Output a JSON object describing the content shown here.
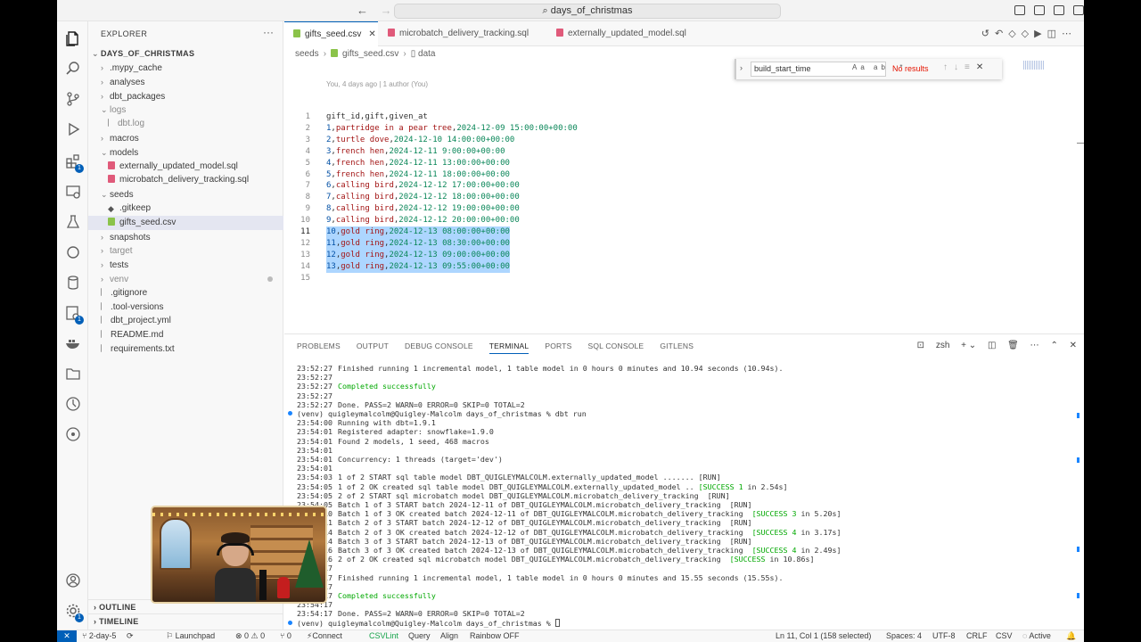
{
  "titlebar": {
    "back": "←",
    "forward": "→",
    "search_icon": "⌕",
    "command_center": "days_of_christmas"
  },
  "sidebar": {
    "header": "EXPLORER",
    "more": "···",
    "root": "DAYS_OF_CHRISTMAS",
    "items": [
      {
        "label": ".mypy_cache",
        "type": "folder",
        "open": false,
        "depth": 1
      },
      {
        "label": "analyses",
        "type": "folder",
        "open": false,
        "depth": 1
      },
      {
        "label": "dbt_packages",
        "type": "folder",
        "open": false,
        "depth": 1
      },
      {
        "label": "logs",
        "type": "folder",
        "open": true,
        "depth": 1,
        "dim": true
      },
      {
        "label": "dbt.log",
        "type": "file",
        "icon": "txt",
        "depth": 2,
        "dim": true
      },
      {
        "label": "macros",
        "type": "folder",
        "open": false,
        "depth": 1
      },
      {
        "label": "models",
        "type": "folder",
        "open": true,
        "depth": 1
      },
      {
        "label": "externally_updated_model.sql",
        "type": "file",
        "icon": "sql",
        "depth": 2
      },
      {
        "label": "microbatch_delivery_tracking.sql",
        "type": "file",
        "icon": "sql",
        "depth": 2
      },
      {
        "label": "seeds",
        "type": "folder",
        "open": true,
        "depth": 1
      },
      {
        "label": ".gitkeep",
        "type": "file",
        "icon": "git",
        "depth": 2
      },
      {
        "label": "gifts_seed.csv",
        "type": "file",
        "icon": "csv",
        "depth": 2,
        "selected": true
      },
      {
        "label": "snapshots",
        "type": "folder",
        "open": false,
        "depth": 1
      },
      {
        "label": "target",
        "type": "folder",
        "open": false,
        "depth": 1,
        "dim": true
      },
      {
        "label": "tests",
        "type": "folder",
        "open": false,
        "depth": 1
      },
      {
        "label": "venv",
        "type": "folder",
        "open": false,
        "depth": 1,
        "dim": true
      },
      {
        "label": ".gitignore",
        "type": "file",
        "icon": "txt",
        "depth": 1
      },
      {
        "label": ".tool-versions",
        "type": "file",
        "icon": "txt",
        "depth": 1
      },
      {
        "label": "dbt_project.yml",
        "type": "file",
        "icon": "txt",
        "depth": 1
      },
      {
        "label": "README.md",
        "type": "file",
        "icon": "txt",
        "depth": 1
      },
      {
        "label": "requirements.txt",
        "type": "file",
        "icon": "txt",
        "depth": 1
      }
    ],
    "outline": "OUTLINE",
    "timeline": "TIMELINE"
  },
  "editor": {
    "tabs": [
      {
        "label": "gifts_seed.csv",
        "icon": "csv",
        "active": true
      },
      {
        "label": "microbatch_delivery_tracking.sql",
        "icon": "sql",
        "active": false
      },
      {
        "label": "externally_updated_model.sql",
        "icon": "sql",
        "active": false
      }
    ],
    "close": "✕",
    "breadcrumb": [
      "seeds",
      "gifts_seed.csv",
      "data"
    ],
    "blame": "You, 4 days ago | 1 author (You)",
    "lines": [
      "gift_id,gift,given_at",
      "1,partridge in a pear tree,2024-12-09 15:00:00+00:00",
      "2,turtle dove,2024-12-10 14:00:00+00:00",
      "3,french hen,2024-12-11 9:00:00+00:00",
      "4,french hen,2024-12-11 13:00:00+00:00",
      "5,french hen,2024-12-11 18:00:00+00:00",
      "6,calling bird,2024-12-12 17:00:00+00:00",
      "7,calling bird,2024-12-12 18:00:00+00:00",
      "8,calling bird,2024-12-12 19:00:00+00:00",
      "9,calling bird,2024-12-12 20:00:00+00:00",
      "10,gold ring,2024-12-13 08:00:00+00:00",
      "11,gold ring,2024-12-13 08:30:00+00:00",
      "12,gold ring,2024-12-13 09:00:00+00:00",
      "13,gold ring,2024-12-13 09:55:00+00:00",
      ""
    ],
    "selected_lines": [
      11,
      12,
      13,
      14
    ],
    "current_line": 11
  },
  "find": {
    "query": "build_start_time",
    "options": "Aa ab .*",
    "result": "No results"
  },
  "panel": {
    "tabs": [
      "PROBLEMS",
      "OUTPUT",
      "DEBUG CONSOLE",
      "TERMINAL",
      "PORTS",
      "SQL CONSOLE",
      "GITLENS"
    ],
    "active_tab": "TERMINAL",
    "shell": "zsh",
    "terminal": [
      {
        "ts": "23:52:27",
        "text": "Finished running 1 incremental model, 1 table model in 0 hours 0 minutes and 10.94 seconds (10.94s)."
      },
      {
        "ts": "23:52:27",
        "text": ""
      },
      {
        "ts": "23:52:27",
        "text": "Completed successfully",
        "green": true
      },
      {
        "ts": "23:52:27",
        "text": ""
      },
      {
        "ts": "23:52:27",
        "text": "Done. PASS=2 WARN=0 ERROR=0 SKIP=0 TOTAL=2"
      },
      {
        "ts": "",
        "text": "(venv) quigleymalcolm@Quigley-Malcolm days_of_christmas % dbt run",
        "prompt": true
      },
      {
        "ts": "23:54:00",
        "text": "Running with dbt=1.9.1"
      },
      {
        "ts": "23:54:01",
        "text": "Registered adapter: snowflake=1.9.0"
      },
      {
        "ts": "23:54:01",
        "text": "Found 2 models, 1 seed, 468 macros"
      },
      {
        "ts": "23:54:01",
        "text": ""
      },
      {
        "ts": "23:54:01",
        "text": "Concurrency: 1 threads (target='dev')"
      },
      {
        "ts": "23:54:01",
        "text": ""
      },
      {
        "ts": "23:54:03",
        "text": "1 of 2 START sql table model DBT_QUIGLEYMALCOLM.externally_updated_model ....... [RUN]"
      },
      {
        "ts": "23:54:05",
        "text": "1 of 2 OK created sql table model DBT_QUIGLEYMALCOLM.externally_updated_model .. ",
        "green_tail": "[SUCCESS 1",
        "tail": " in 2.54s]"
      },
      {
        "ts": "23:54:05",
        "text": "2 of 2 START sql microbatch model DBT_QUIGLEYMALCOLM.microbatch_delivery_tracking  [RUN]"
      },
      {
        "ts": "23:54:05",
        "text": "Batch 1 of 3 START batch 2024-12-11 of DBT_QUIGLEYMALCOLM.microbatch_delivery_tracking  [RUN]"
      },
      {
        "ts": "23:54:10",
        "text": "Batch 1 of 3 OK created batch 2024-12-11 of DBT_QUIGLEYMALCOLM.microbatch_delivery_tracking  ",
        "green_tail": "[SUCCESS 3",
        "tail": " in 5.20s]"
      },
      {
        "ts": "23:54:11",
        "text": "Batch 2 of 3 START batch 2024-12-12 of DBT_QUIGLEYMALCOLM.microbatch_delivery_tracking  [RUN]"
      },
      {
        "ts": "23:54:14",
        "text": "Batch 2 of 3 OK created batch 2024-12-12 of DBT_QUIGLEYMALCOLM.microbatch_delivery_tracking  ",
        "green_tail": "[SUCCESS 4",
        "tail": " in 3.17s]"
      },
      {
        "ts": "23:54:14",
        "text": "Batch 3 of 3 START batch 2024-12-13 of DBT_QUIGLEYMALCOLM.microbatch_delivery_tracking  [RUN]"
      },
      {
        "ts": "23:54:16",
        "text": "Batch 3 of 3 OK created batch 2024-12-13 of DBT_QUIGLEYMALCOLM.microbatch_delivery_tracking  ",
        "green_tail": "[SUCCESS 4",
        "tail": " in 2.49s]"
      },
      {
        "ts": "23:54:16",
        "text": "2 of 2 OK created sql microbatch model DBT_QUIGLEYMALCOLM.microbatch_delivery_tracking  ",
        "green_tail": "[SUCCESS",
        "tail": " in 10.86s]"
      },
      {
        "ts": "23:54:17",
        "text": ""
      },
      {
        "ts": "23:54:17",
        "text": "Finished running 1 incremental model, 1 table model in 0 hours 0 minutes and 15.55 seconds (15.55s)."
      },
      {
        "ts": "23:54:17",
        "text": ""
      },
      {
        "ts": "23:54:17",
        "text": "Completed successfully",
        "green": true
      },
      {
        "ts": "23:54:17",
        "text": ""
      },
      {
        "ts": "23:54:17",
        "text": "Done. PASS=2 WARN=0 ERROR=0 SKIP=0 TOTAL=2"
      },
      {
        "ts": "",
        "text": "(venv) quigleymalcolm@Quigley-Malcolm days_of_christmas % ",
        "prompt": true,
        "cursor": true
      }
    ]
  },
  "statusbar": {
    "remote": "✕",
    "branch": "2-day-5",
    "launchpad": "Launchpad",
    "errors": "⊗ 0 ⚠ 0",
    "ports": "⑂ 0",
    "connect": "Connect",
    "csvlint": "CSVLint",
    "query": "Query",
    "align": "Align",
    "rainbow": "Rainbow OFF",
    "position": "Ln 11, Col 1 (158 selected)",
    "spaces": "Spaces: 4",
    "encoding": "UTF-8",
    "eol": "CRLF",
    "language": "CSV",
    "active": "Active"
  },
  "colors": {
    "accent": "#005fb8",
    "selection": "#add6ff",
    "success_green": "#00a800",
    "error_red": "#e51400",
    "sql_icon": "#e05a7a",
    "csv_icon": "#8bc34a"
  }
}
